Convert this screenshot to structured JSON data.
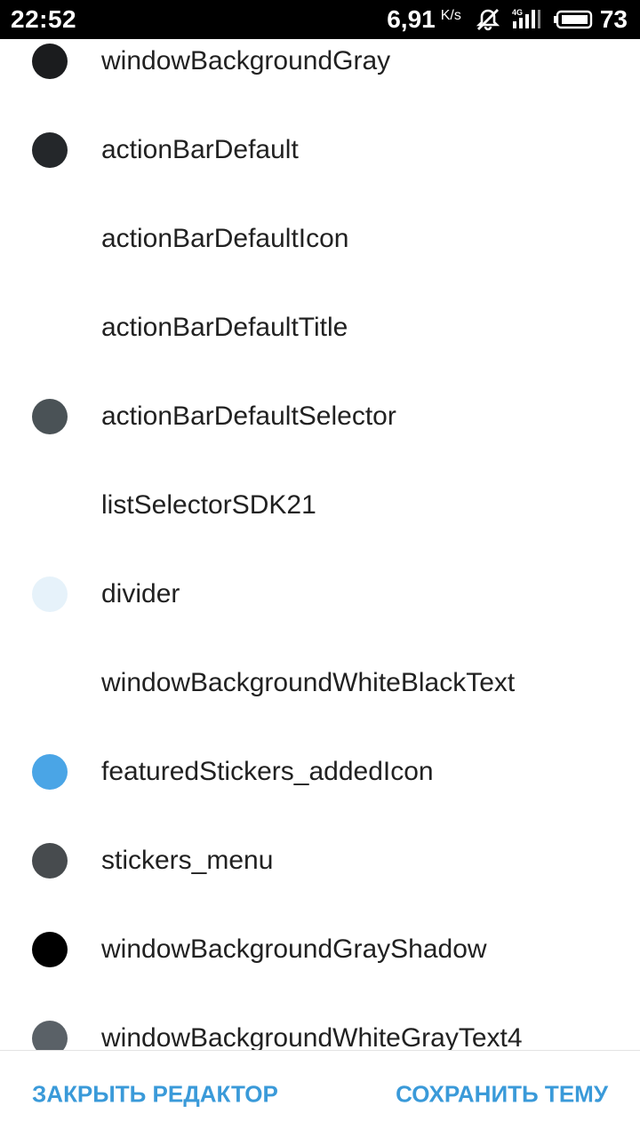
{
  "status_bar": {
    "time": "22:52",
    "net_speed": "6,91",
    "net_unit": "K/s",
    "battery_level": "73",
    "icons": [
      "notifications-muted-icon",
      "signal-4g-icon",
      "battery-icon"
    ]
  },
  "theme_items": [
    {
      "label": "windowBackgroundGray",
      "color": "#1b1c1e"
    },
    {
      "label": "actionBarDefault",
      "color": "#24272a"
    },
    {
      "label": "actionBarDefaultIcon",
      "color": null
    },
    {
      "label": "actionBarDefaultTitle",
      "color": null
    },
    {
      "label": "actionBarDefaultSelector",
      "color": "#4a5256"
    },
    {
      "label": "listSelectorSDK21",
      "color": null
    },
    {
      "label": "divider",
      "color": "#e6f2fa"
    },
    {
      "label": "windowBackgroundWhiteBlackText",
      "color": null
    },
    {
      "label": "featuredStickers_addedIcon",
      "color": "#4aa5e6"
    },
    {
      "label": "stickers_menu",
      "color": "#474b4e"
    },
    {
      "label": "windowBackgroundGrayShadow",
      "color": "#000000"
    },
    {
      "label": "windowBackgroundWhiteGrayText4",
      "color": "#5a6167"
    }
  ],
  "footer": {
    "close_label": "ЗАКРЫТЬ РЕДАКТОР",
    "save_label": "СОХРАНИТЬ ТЕМУ",
    "accent_color": "#3a9ad9"
  }
}
